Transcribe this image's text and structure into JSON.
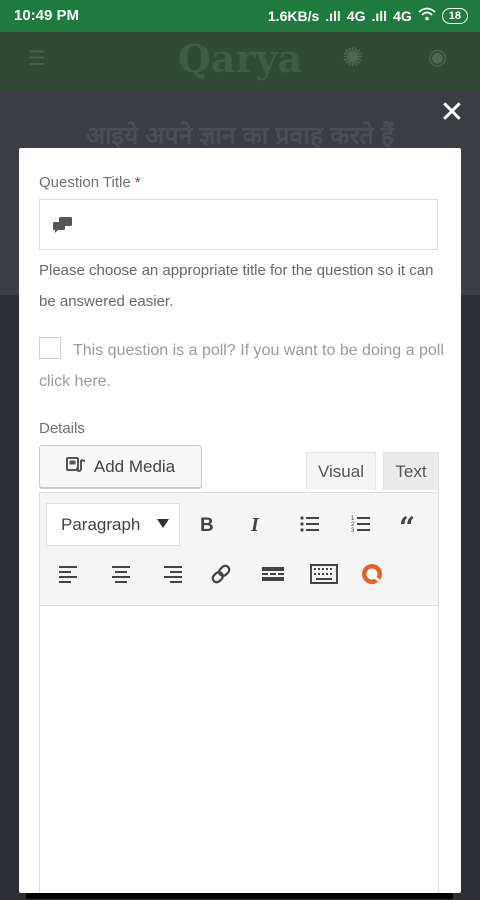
{
  "status_bar": {
    "time": "10:49 PM",
    "network": "1.6KB/s",
    "sim1": "4G",
    "sim2": "4G",
    "battery": "18"
  },
  "app": {
    "title": "Qarya",
    "banner_text": "आइये अपने ज्ञान का प्रवाह करते हैं"
  },
  "modal": {
    "close_icon": "close-icon",
    "question_title_label": "Question Title",
    "required_mark": "*",
    "help_text": "Please choose an appropriate title for the question so it can be answered easier.",
    "poll_label": "This question is a poll? If you want to be doing a poll click here.",
    "poll_checked": false,
    "details_label": "Details",
    "add_media_label": "Add Media",
    "tabs": {
      "visual": "Visual",
      "text": "Text"
    },
    "format_select_value": "Paragraph",
    "toolbar_icons": [
      "bold-icon",
      "italic-icon",
      "bulleted-list-icon",
      "numbered-list-icon",
      "blockquote-icon",
      "align-left-icon",
      "align-center-icon",
      "align-right-icon",
      "link-icon",
      "read-more-icon",
      "toolbar-toggle-icon",
      "plugin-icon"
    ],
    "accent_color": "#e2622a"
  }
}
